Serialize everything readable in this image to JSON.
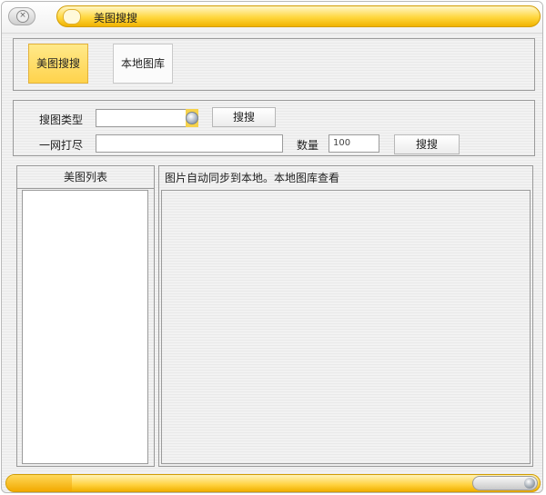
{
  "window": {
    "title": "美图搜搜"
  },
  "tabs": [
    {
      "label": "美图搜搜",
      "active": true
    },
    {
      "label": "本地图库",
      "active": false
    }
  ],
  "search": {
    "type_label": "搜图类型",
    "type_value": "",
    "search_button": "搜搜",
    "keyword_label": "一网打尽",
    "keyword_value": "",
    "count_label": "数量",
    "count_value": "100",
    "search_button2": "搜搜"
  },
  "list": {
    "header": "美图列表"
  },
  "status": {
    "text": "图片自动同步到本地。本地图库查看"
  },
  "colors": {
    "accent": "#ffd34c",
    "accent_dark": "#f0b000",
    "border": "#9a9a9a"
  }
}
